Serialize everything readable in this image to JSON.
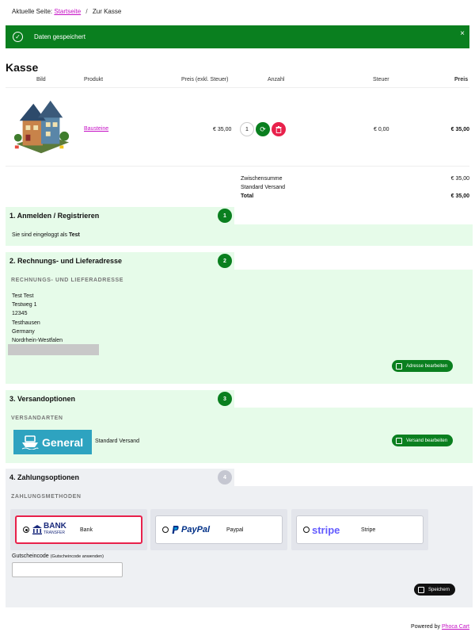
{
  "breadcrumb": {
    "prefix": "Aktuelle Seite:",
    "home": "Startseite",
    "separator": "/",
    "current": "Zur Kasse"
  },
  "alert": {
    "message": "Daten gespeichert",
    "close": "×",
    "color": "#0a7f1f"
  },
  "page_title": "Kasse",
  "cart": {
    "headers": {
      "image": "Bild",
      "product": "Produkt",
      "price": "Preis (exkl. Steuer)",
      "qty": "Anzahl",
      "tax": "Steuer",
      "total": "Preis"
    },
    "item": {
      "product": "Bausteine",
      "price": "€ 35,00",
      "qty": "1",
      "tax": "€ 0,00",
      "total": "€ 35,00"
    },
    "totals": [
      {
        "label": "Zwischensumme",
        "value": "€ 35,00",
        "bold": false
      },
      {
        "label": "Standard Versand",
        "value": "",
        "bold": false
      },
      {
        "label": "Total",
        "value": "€ 35,00",
        "bold": true
      }
    ]
  },
  "steps": {
    "login": {
      "title": "1. Anmelden / Registrieren",
      "number": "1",
      "text_prefix": "Sie sind eingeloggt als",
      "user": "Test"
    },
    "address": {
      "title": "2. Rechnungs- und Lieferadresse",
      "number": "2",
      "section": "RECHNUNGS- UND LIEFERADRESSE",
      "lines": [
        "Test Test",
        "Testweg 1",
        "12345",
        "Testhausen",
        "Germany",
        "Nordrhein-Westfalen"
      ],
      "edit_button": "Adresse bearbeiten"
    },
    "shipping": {
      "title": "3. Versandoptionen",
      "number": "3",
      "section": "VERSANDARTEN",
      "logo_text": "General",
      "method": "Standard Versand",
      "edit_button": "Versand bearbeiten"
    },
    "payment": {
      "title": "4. Zahlungsoptionen",
      "number": "4",
      "section": "ZAHLUNGSMETHODEN",
      "methods": [
        {
          "logo_main": "BANK",
          "logo_sub": "TRANSFER",
          "label": "Bank",
          "selected": true
        },
        {
          "logo_main": "PayPal",
          "label": "Paypal",
          "selected": false
        },
        {
          "logo_main": "stripe",
          "label": "Stripe",
          "selected": false
        }
      ],
      "coupon_label": "Gutscheincode",
      "coupon_hint": "(Gutscheincode anwenden)",
      "save_button": "Speichern"
    }
  },
  "footer": {
    "prefix": "Powered by",
    "link": "Phoca Cart"
  },
  "colors": {
    "green": "#0a7f1f",
    "mint": "#e6fbe9",
    "magenta": "#c511c5",
    "red": "#e8214b",
    "grey_panel": "#eef0f3"
  }
}
